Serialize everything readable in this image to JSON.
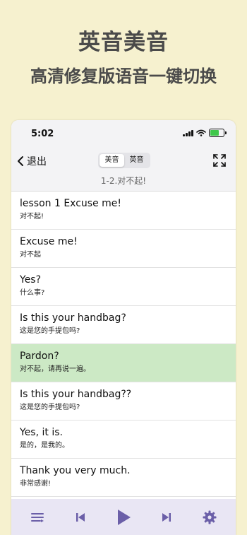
{
  "banner": {
    "headline": "英音美音",
    "subline": "高清修复版语音一键切换"
  },
  "status_bar": {
    "time": "5:02"
  },
  "nav": {
    "back_label": "退出",
    "segments": [
      {
        "label": "美音",
        "active": true
      },
      {
        "label": "英音",
        "active": false
      }
    ],
    "subtitle": "1-2.对不起!"
  },
  "lessons": [
    {
      "en": "lesson 1 Excuse me!",
      "zh": "对不起!",
      "active": false
    },
    {
      "en": "Excuse me!",
      "zh": "对不起",
      "active": false
    },
    {
      "en": "Yes?",
      "zh": "什么事?",
      "active": false
    },
    {
      "en": "Is this your handbag?",
      "zh": "这是您的手提包吗?",
      "active": false
    },
    {
      "en": "Pardon?",
      "zh": "对不起，请再说一遍。",
      "active": true
    },
    {
      "en": "Is this your handbag??",
      "zh": "这是您的手提包吗?",
      "active": false
    },
    {
      "en": "Yes, it is.",
      "zh": "是的，是我的。",
      "active": false
    },
    {
      "en": "Thank you very much.",
      "zh": "非常感谢!",
      "active": false
    }
  ],
  "toolbar": {
    "icons": [
      "list-icon",
      "previous-icon",
      "play-icon",
      "next-icon",
      "settings-icon"
    ]
  },
  "colors": {
    "background": "#f6f1cf",
    "active_row": "#cce9c5",
    "toolbar_bg": "#e9e6f4",
    "toolbar_icon": "#6b5fa8",
    "battery": "#3fc74b"
  },
  "battery_level": 0.7
}
